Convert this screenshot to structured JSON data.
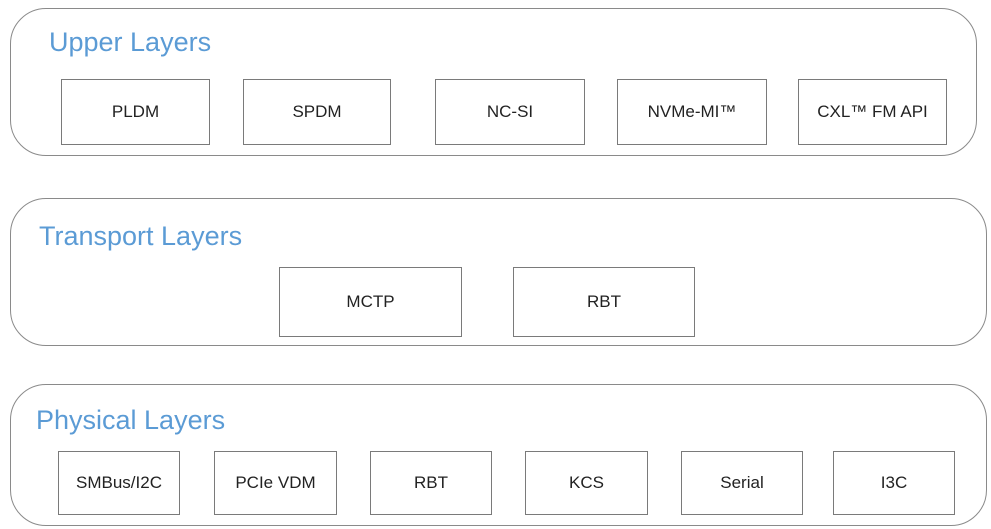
{
  "layers": {
    "upper": {
      "title": "Upper Layers",
      "items": [
        "PLDM",
        "SPDM",
        "NC-SI",
        "NVMe-MI™",
        "CXL™ FM API"
      ]
    },
    "transport": {
      "title": "Transport Layers",
      "items": [
        "MCTP",
        "RBT"
      ]
    },
    "physical": {
      "title": "Physical Layers",
      "items": [
        "SMBus/I2C",
        "PCIe VDM",
        "RBT",
        "KCS",
        "Serial",
        "I3C"
      ]
    }
  },
  "colors": {
    "title": "#5b9bd5",
    "border": "#8a8a8a",
    "text": "#222222"
  }
}
